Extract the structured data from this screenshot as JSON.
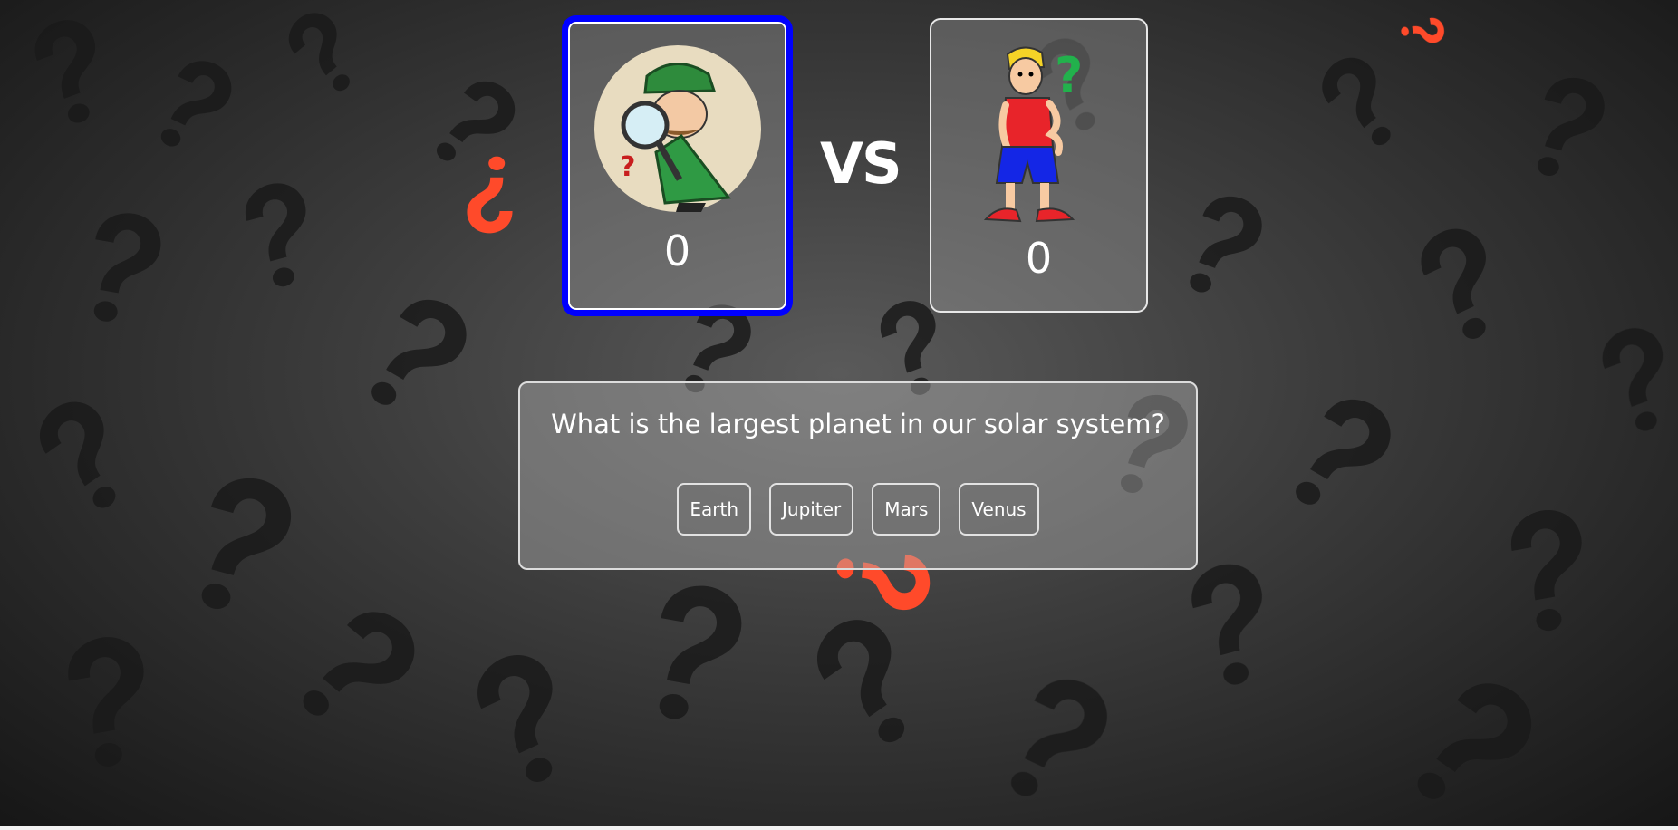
{
  "players": [
    {
      "name": "detective",
      "score": "0",
      "active": true
    },
    {
      "name": "confused-boy",
      "score": "0",
      "active": false
    }
  ],
  "versus_label": "VS",
  "quiz": {
    "question": "What is the largest planet in our solar system?",
    "answers": [
      "Earth",
      "Jupiter",
      "Mars",
      "Venus"
    ]
  },
  "colors": {
    "active_border": "#0000ff",
    "accent_question_mark": "#ff4a2a",
    "background": "#2a2a2a"
  }
}
